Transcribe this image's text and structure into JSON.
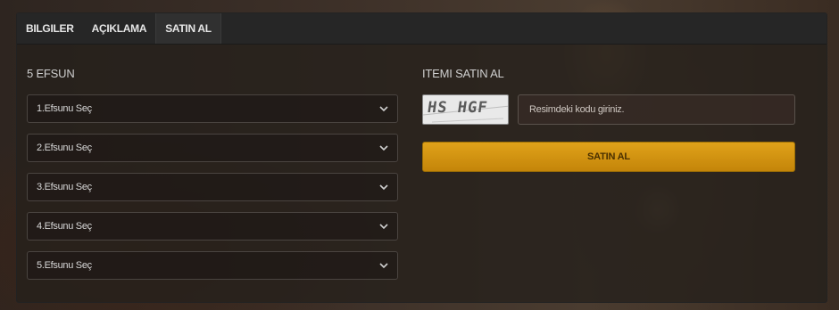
{
  "tabs": [
    {
      "label": "BILGILER"
    },
    {
      "label": "AÇIKLAMA"
    },
    {
      "label": "SATIN AL"
    }
  ],
  "left_section": {
    "title": "5 EFSUN",
    "selects": [
      {
        "label": "1.Efsunu Seç"
      },
      {
        "label": "2.Efsunu Seç"
      },
      {
        "label": "3.Efsunu Seç"
      },
      {
        "label": "4.Efsunu Seç"
      },
      {
        "label": "5.Efsunu Seç"
      }
    ]
  },
  "right_section": {
    "title": "ITEMI SATIN AL",
    "captcha_text": "HS HGF",
    "code_placeholder": "Resimdeki kodu giriniz.",
    "buy_label": "SATIN AL"
  },
  "colors": {
    "accent_button": "#d39412",
    "panel_background": "#26201c"
  },
  "icons": {
    "select_arrow": "chevron-down-icon"
  }
}
